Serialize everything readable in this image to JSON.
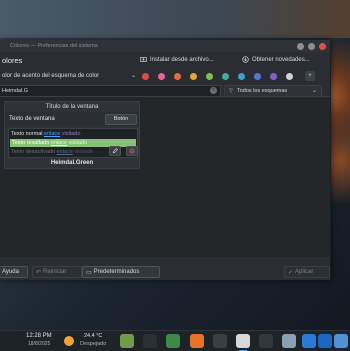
{
  "window": {
    "title": "Colores — Preferencias del sistema",
    "header_title": "olores",
    "install_label": "Instalar desde archivo...",
    "get_new_label": "Obtener novedades..."
  },
  "scheme_row": {
    "label": "olor de acento del esquema de color",
    "swatches": [
      "#e34a4a",
      "#e5649a",
      "#e56c47",
      "#e8a531",
      "#7fbf49",
      "#3fae96",
      "#37a5cf",
      "#5577d6",
      "#8a5bd4",
      "#cfd2d6"
    ],
    "more_label": "+"
  },
  "search": {
    "value": "Heimdal.G",
    "filter_label": "Todos los esquemas"
  },
  "preview": {
    "window_title": "Título de la ventana",
    "window_text": "Texto de ventana",
    "button_label": "Botón",
    "normal_text": "Texto normal",
    "selected_text": "Texto resaltado",
    "disabled_text": "Texto desactivado",
    "link_word": "enlace",
    "visited_word": "visitado",
    "scheme_name": "Heimdal.Green"
  },
  "bottom": {
    "help_label": "Ayuda",
    "reset_label": "Reiniciar",
    "defaults_label": "Predeterminados",
    "apply_label": "Aplicar"
  },
  "taskbar": {
    "time": "12:28 PM",
    "date": "18/8/2025",
    "temperature": "24.4 °C",
    "condition": "Despejado",
    "apps": [
      {
        "name": "plasma-app-icon",
        "color": "#6f9b4b"
      },
      {
        "name": "terminal-app-icon",
        "color": "#2c2f33"
      },
      {
        "name": "files-app-icon",
        "color": "#3b8a4a"
      },
      {
        "name": "firefox-app-icon",
        "color": "#e8722a"
      },
      {
        "name": "dark-app-icon",
        "color": "#3a3f44"
      },
      {
        "name": "chrome-app-icon",
        "color": "#d8d8d8"
      },
      {
        "name": "console-app-icon",
        "color": "#33383d"
      },
      {
        "name": "settings-app-icon",
        "color": "#8aa0b5"
      },
      {
        "name": "mail-app-icon",
        "color": "#2a7bd8"
      },
      {
        "name": "outlook-app-icon",
        "color": "#1d67c4"
      },
      {
        "name": "system-settings-app-icon",
        "color": "#4f93d6"
      }
    ]
  }
}
